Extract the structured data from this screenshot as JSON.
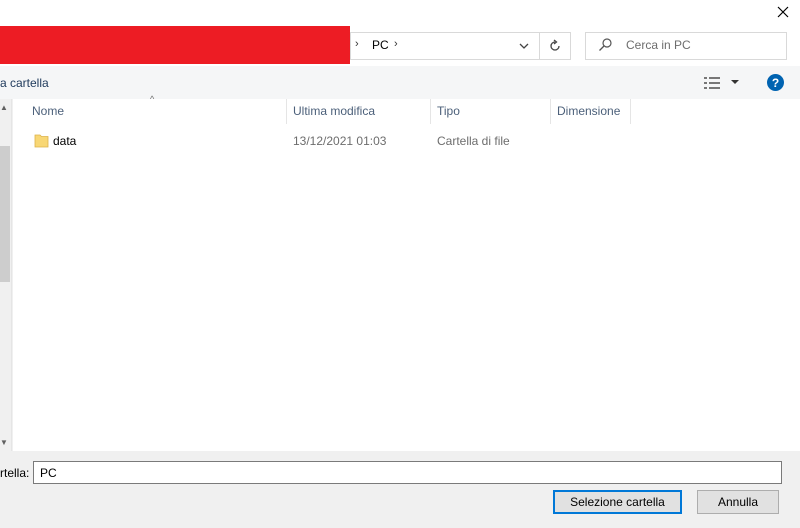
{
  "window": {
    "close_glyph": "✕"
  },
  "address": {
    "separator": "›",
    "location": "PC",
    "dropdown_icon": "chevron-down-icon",
    "refresh_icon": "refresh-icon"
  },
  "search": {
    "placeholder": "Cerca in PC"
  },
  "toolbar": {
    "new_folder_label": "a cartella",
    "view_dropdown_glyph": "▾",
    "help_label": "?"
  },
  "columns": {
    "name": "Nome",
    "modified": "Ultima modifica",
    "type": "Tipo",
    "size": "Dimensione"
  },
  "files": [
    {
      "name": "data",
      "modified": "13/12/2021 01:03",
      "type": "Cartella di file",
      "size": ""
    }
  ],
  "footer": {
    "folder_label": "rtella:",
    "folder_value": "PC",
    "select_label": "Selezione cartella",
    "cancel_label": "Annulla"
  },
  "colors": {
    "redacted": "#ed1c24",
    "accent": "#0078d7",
    "help": "#0063b1",
    "folder": "#f8d775"
  }
}
